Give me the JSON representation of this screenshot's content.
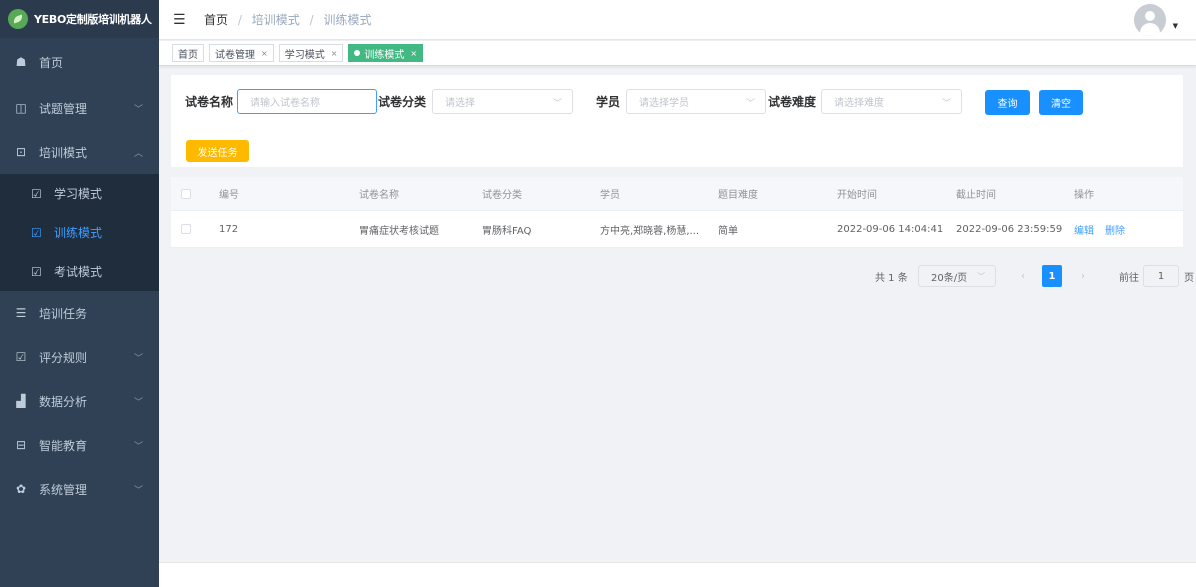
{
  "app": {
    "logo_text": "YEBO定制版培训机器人"
  },
  "sidebar": {
    "items": [
      {
        "label": "首页",
        "icon": "dashboard-icon",
        "glyph": "☗",
        "arrow": ""
      },
      {
        "label": "试题管理",
        "icon": "book-icon",
        "glyph": "◫",
        "arrow": "﹀"
      },
      {
        "label": "培训模式",
        "icon": "monitor-icon",
        "glyph": "⊡",
        "arrow": "︿"
      }
    ],
    "sub_items": [
      {
        "label": "学习模式",
        "icon": "edit-icon",
        "glyph": "☑"
      },
      {
        "label": "训练模式",
        "icon": "edit-icon",
        "glyph": "☑"
      },
      {
        "label": "考试模式",
        "icon": "edit-icon",
        "glyph": "☑"
      }
    ],
    "bottom_items": [
      {
        "label": "培训任务",
        "icon": "list-icon",
        "glyph": "☰",
        "arrow": ""
      },
      {
        "label": "评分规则",
        "icon": "edit-icon",
        "glyph": "☑",
        "arrow": "﹀"
      },
      {
        "label": "数据分析",
        "icon": "bar-chart-icon",
        "glyph": "▟",
        "arrow": "﹀"
      },
      {
        "label": "智能教育",
        "icon": "screen-icon",
        "glyph": "⊟",
        "arrow": "﹀"
      },
      {
        "label": "系统管理",
        "icon": "gear-icon",
        "glyph": "✿",
        "arrow": "﹀"
      }
    ]
  },
  "header": {
    "breadcrumb": [
      "首页",
      "培训模式",
      "训练模式"
    ],
    "separator": "/",
    "hamburger_glyph": "☰",
    "avatar_caret": "▼"
  },
  "tags": [
    {
      "label": "首页",
      "closable": false,
      "active": false
    },
    {
      "label": "试卷管理",
      "closable": true,
      "active": false
    },
    {
      "label": "学习模式",
      "closable": true,
      "active": false
    },
    {
      "label": "训练模式",
      "closable": true,
      "active": true
    }
  ],
  "close_glyph": "×",
  "filters": {
    "paper_name": {
      "label": "试卷名称",
      "placeholder": "请输入试卷名称"
    },
    "paper_category": {
      "label": "试卷分类",
      "placeholder": "请选择"
    },
    "student": {
      "label": "学员",
      "placeholder": "请选择学员"
    },
    "difficulty": {
      "label": "试卷难度",
      "placeholder": "请选择难度"
    },
    "select_caret": "﹀",
    "query_button": "查询",
    "clear_button": "清空",
    "send_task_button": "发送任务"
  },
  "table": {
    "columns": [
      "编号",
      "试卷名称",
      "试卷分类",
      "学员",
      "题目难度",
      "开始时间",
      "截止时间",
      "操作"
    ],
    "rows": [
      {
        "id": "172",
        "name": "胃痛症状考核试题",
        "category": "胃肠科FAQ",
        "students": "方中亮,郑晓蓉,杨慧,...",
        "difficulty": "简单",
        "start": "2022-09-06 14:04:41",
        "end": "2022-09-06 23:59:59",
        "edit": "编辑",
        "delete": "删除"
      }
    ]
  },
  "pagination": {
    "total_text": "共 1 条",
    "page_size": "20条/页",
    "size_caret": "﹀",
    "prev": "‹",
    "current_page": "1",
    "next": "›",
    "goto_label": "前往",
    "goto_value": "1",
    "goto_suffix": "页"
  },
  "colors": {
    "sidebar_bg": "#304156",
    "active_menu": "#409eff",
    "active_tag": "#42b983",
    "primary_button": "#1890ff",
    "warning_button": "#ffba00"
  }
}
